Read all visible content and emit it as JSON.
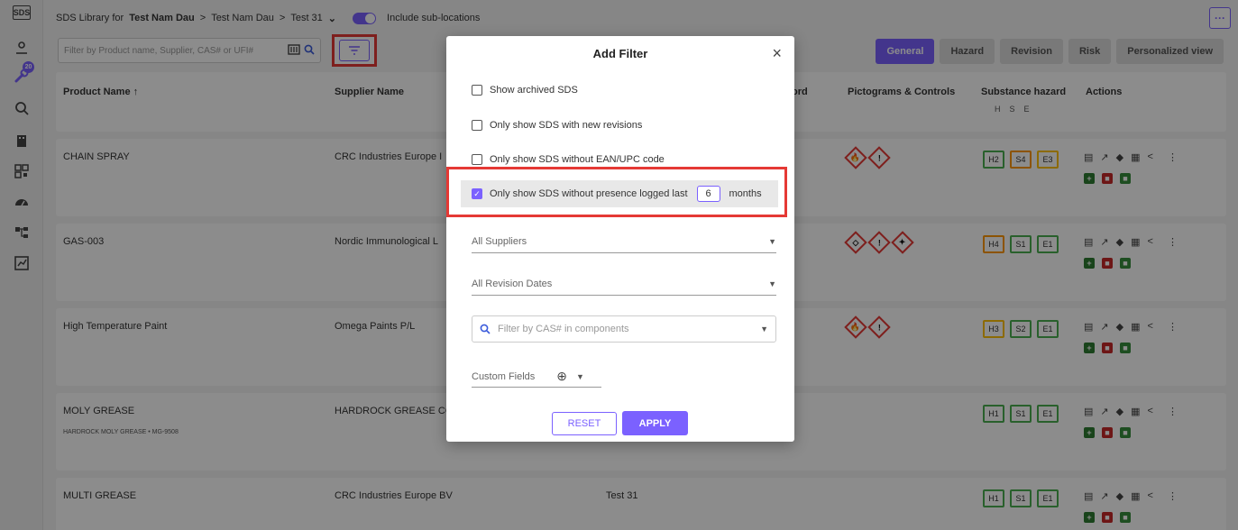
{
  "breadcrumb": {
    "prefix": "SDS Library for",
    "location": "Test Nam Dau",
    "sep": ">",
    "level2": "Test Nam Dau",
    "level3": "Test 31",
    "dropdown": "⌄",
    "sub_locations_label": "Include sub-locations"
  },
  "more_label": "···",
  "search": {
    "placeholder": "Filter by Product name, Supplier, CAS# or UFI#"
  },
  "sidebar": {
    "badge": "20"
  },
  "view_tabs": [
    "General",
    "Hazard",
    "Revision",
    "Risk",
    "Personalized view"
  ],
  "table": {
    "headers": {
      "product": "Product Name ↑",
      "supplier": "Supplier Name",
      "keyword_partial": "ord",
      "pictograms": "Pictograms & Controls",
      "substance_hazard": "Substance hazard",
      "hse": "HSE",
      "actions": "Actions"
    },
    "rows": [
      {
        "product": "CHAIN SPRAY",
        "supplier": "CRC Industries Europe I",
        "sub": "",
        "location": "",
        "hz": [
          "H2",
          "S4",
          "E3"
        ]
      },
      {
        "product": "GAS-003",
        "supplier": "Nordic Immunological L",
        "sub": "",
        "location": "",
        "hz": [
          "H4",
          "S1",
          "E1"
        ]
      },
      {
        "product": "High Temperature Paint",
        "supplier": "Omega Paints P/L",
        "sub": "",
        "location": "",
        "hz": [
          "H3",
          "S2",
          "E1"
        ]
      },
      {
        "product": "MOLY GREASE",
        "supplier": "HARDROCK GREASE CO",
        "sub": "HARDROCK MOLY GREASE • MG-9508",
        "location": "",
        "hz": [
          "H1",
          "S1",
          "E1"
        ]
      },
      {
        "product": "MULTI GREASE",
        "supplier": "CRC Industries Europe BV",
        "sub": "",
        "location": "Test 31",
        "hz": [
          "H1",
          "S1",
          "E1"
        ]
      }
    ]
  },
  "modal": {
    "title": "Add Filter",
    "close": "×",
    "options": [
      "Show archived SDS",
      "Only show SDS with new revisions",
      "Only show SDS without EAN/UPC code"
    ],
    "presence": {
      "before": "Only show SDS without presence logged last",
      "value": "6",
      "after": "months"
    },
    "suppliers": "All Suppliers",
    "revision_dates": "All Revision Dates",
    "cas_placeholder": "Filter by CAS# in components",
    "custom_fields": "Custom Fields",
    "reset": "RESET",
    "apply": "APPLY"
  },
  "colors": {
    "accent": "#7b61ff",
    "highlight": "#e53935"
  }
}
